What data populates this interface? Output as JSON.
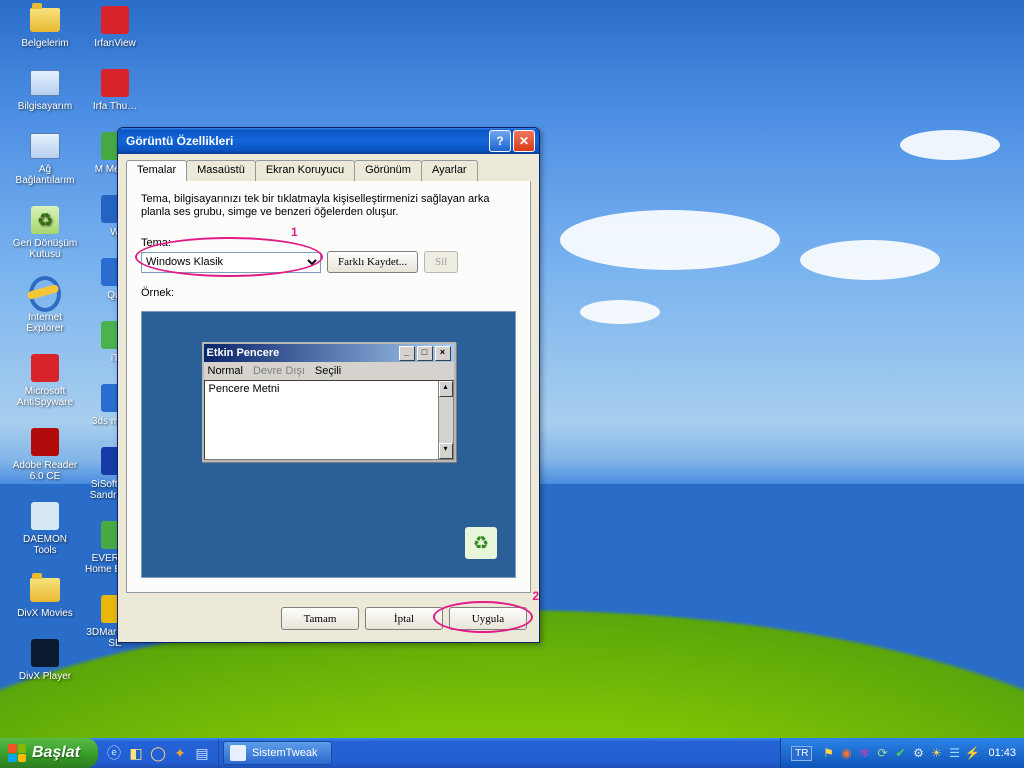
{
  "desktop_icons": [
    {
      "name": "belgelerim",
      "label": "Belgelerim",
      "glyph": "folder"
    },
    {
      "name": "bilgisayarim",
      "label": "Bilgisayarım",
      "glyph": "pc"
    },
    {
      "name": "ag",
      "label": "Ağ Bağlantılarım",
      "glyph": "pc"
    },
    {
      "name": "geri",
      "label": "Geri Dönüşüm Kutusu",
      "glyph": "recycle"
    },
    {
      "name": "ie",
      "label": "Internet Explorer",
      "glyph": "ie"
    },
    {
      "name": "antispyware",
      "label": "Microsoft AntiSpyware",
      "glyph": "sq",
      "color": "#d8232a"
    },
    {
      "name": "adobe",
      "label": "Adobe Reader 6.0 CE",
      "glyph": "sq",
      "color": "#b30b0b"
    },
    {
      "name": "daemon",
      "label": "DAEMON Tools",
      "glyph": "sq",
      "color": "#d6e8f4"
    },
    {
      "name": "divxmovies",
      "label": "DivX Movies",
      "glyph": "folder"
    },
    {
      "name": "divx",
      "label": "DivX Player",
      "glyph": "sq",
      "color": "#0a1a2e"
    },
    {
      "name": "irfan",
      "label": "IrfanView",
      "glyph": "sq",
      "color": "#d8232a"
    },
    {
      "name": "irfathumb",
      "label": "Irfa Thu…",
      "glyph": "sq",
      "color": "#d8232a"
    },
    {
      "name": "msn",
      "label": "M Messe",
      "glyph": "sq",
      "color": "#44a942"
    },
    {
      "name": "wmp",
      "label": "W",
      "glyph": "sq",
      "color": "#2463c2"
    },
    {
      "name": "qt",
      "label": "Qui",
      "glyph": "sq",
      "color": "#2a6dd1"
    },
    {
      "name": "itunes",
      "label": "iT",
      "glyph": "sq",
      "color": "#4bb24e"
    },
    {
      "name": "3dsmax",
      "label": "3ds max 7",
      "glyph": "sq",
      "color": "#2a6dd1"
    },
    {
      "name": "sisoftware",
      "label": "SiSoftware Sandra L…",
      "glyph": "sq",
      "color": "#1539a7"
    },
    {
      "name": "everest",
      "label": "EVEREST Home Edition",
      "glyph": "sq",
      "color": "#49a942"
    },
    {
      "name": "3dmark",
      "label": "3DMark2001 SE",
      "glyph": "sq",
      "color": "#e8b70a"
    }
  ],
  "dialog": {
    "title": "Görüntü Özellikleri",
    "tabs": [
      "Temalar",
      "Masaüstü",
      "Ekran Koruyucu",
      "Görünüm",
      "Ayarlar"
    ],
    "active_tab": 0,
    "description": "Tema, bilgisayarınızı tek bir tıklatmayla kişiselleştirmenizi sağlayan arka planla ses grubu, simge ve benzeri öğelerden oluşur.",
    "theme_label": "Tema:",
    "theme_selected": "Windows Klasik",
    "save_as": "Farklı Kaydet...",
    "delete": "Sil",
    "example_label": "Örnek:",
    "preview": {
      "title": "Etkin Pencere",
      "menu": [
        "Normal",
        "Devre Dışı",
        "Seçili"
      ],
      "body": "Pencere Metni"
    },
    "buttons": {
      "ok": "Tamam",
      "cancel": "İptal",
      "apply": "Uygula"
    },
    "annotations": {
      "a1": "1",
      "a2": "2"
    }
  },
  "taskbar": {
    "start": "Başlat",
    "task_item": "SistemTweak",
    "lang": "TR",
    "clock": "01:43"
  }
}
